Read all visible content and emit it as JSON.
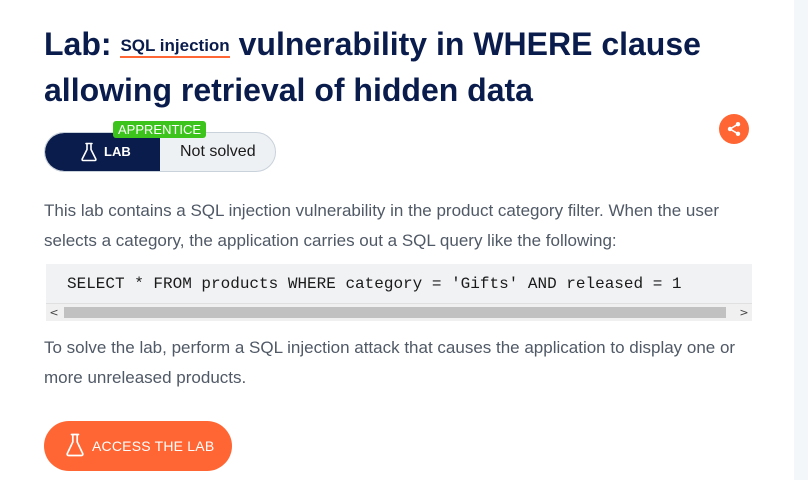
{
  "title": {
    "prefix": "Lab:",
    "term": "SQL injection",
    "rest": "vulnerability in WHERE clause allowing retrieval of hidden data"
  },
  "status": {
    "level_badge": "APPRENTICE",
    "lab_label": "LAB",
    "solved_text": "Not solved"
  },
  "description": "This lab contains a SQL injection vulnerability in the product category filter. When the user selects a category, the application carries out a SQL query like the following:",
  "code": "SELECT * FROM products WHERE category = 'Gifts' AND released = 1",
  "scroll": {
    "left_arrow": "<",
    "right_arrow": ">"
  },
  "instructions": "To solve the lab, perform a SQL injection attack that causes the application to display one or more unreleased products.",
  "access_button": {
    "label": "ACCESS THE LAB"
  },
  "icons": {
    "share": "share-icon",
    "flask": "flask-icon"
  },
  "colors": {
    "navy": "#0a1c4c",
    "accent": "#ff6633",
    "apprentice_green": "#3cc41d"
  }
}
